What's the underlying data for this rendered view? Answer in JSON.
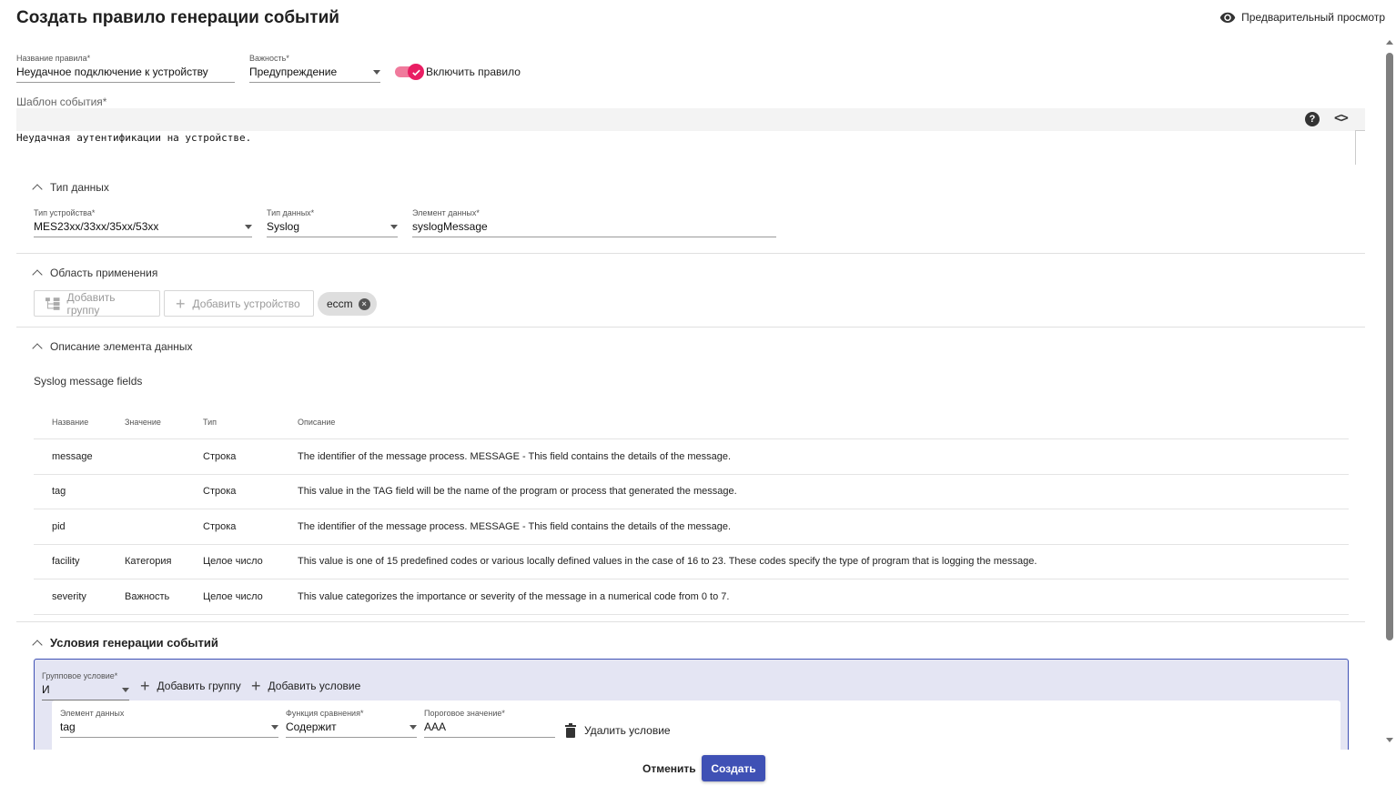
{
  "page": {
    "title": "Создать правило генерации событий",
    "preview_label": "Предварительный просмотр"
  },
  "rule": {
    "name_label": "Название правила*",
    "name_value": "Неудачное подключение к устройству",
    "severity_label": "Важность*",
    "severity_value": "Предупреждение",
    "enable_label": "Включить правило",
    "enabled": true
  },
  "template": {
    "label": "Шаблон события*",
    "text": "Неудачная аутентификации на устройстве.",
    "help_icon": "?",
    "code_icon": "<>"
  },
  "data_type_section": {
    "title": "Тип данных",
    "device_type_label": "Тип устройства*",
    "device_type_value": "MES23xx/33xx/35xx/53xx",
    "data_type_label": "Тип данных*",
    "data_type_value": "Syslog",
    "data_element_label": "Элемент данных*",
    "data_element_value": "syslogMessage"
  },
  "scope_section": {
    "title": "Область применения",
    "add_group_label": "Добавить группу",
    "add_device_label": "Добавить устройство",
    "chip_label": "eccm",
    "chip_remove_icon": "×"
  },
  "description_section": {
    "title": "Описание элемента данных",
    "subtitle": "Syslog message fields",
    "columns": [
      "Название",
      "Значение",
      "Тип",
      "Описание"
    ],
    "rows": [
      [
        "message",
        "",
        "Строка",
        "The identifier of the message process. MESSAGE - This field contains the details of the message."
      ],
      [
        "tag",
        "",
        "Строка",
        "This value in the TAG field will be the name of the program or process that generated the message."
      ],
      [
        "pid",
        "",
        "Строка",
        "The identifier of the message process. MESSAGE - This field contains the details of the message."
      ],
      [
        "facility",
        "Категория",
        "Целое число",
        "This value is one of 15 predefined codes or various locally defined values in the case of 16 to 23. These codes specify the type of program that is logging the message."
      ],
      [
        "severity",
        "Важность",
        "Целое число",
        "This value categorizes the importance or severity of the message in a numerical code from 0 to 7."
      ]
    ]
  },
  "conditions_section": {
    "title": "Условия генерации событий",
    "group_condition_label": "Групповое условие*",
    "group_condition_value": "И",
    "add_group_label": "Добавить группу",
    "add_condition_label": "Добавить условие",
    "condition": {
      "data_element_label": "Элемент данных",
      "data_element_value": "tag",
      "compare_label": "Функция сравнения*",
      "compare_value": "Содержит",
      "threshold_label": "Пороговое значение*",
      "threshold_value": "AAA",
      "delete_label": "Удалить условие"
    }
  },
  "footer": {
    "cancel_label": "Отменить",
    "create_label": "Создать"
  },
  "colors": {
    "accent": "#3f51b5",
    "toggle": "#e91e63",
    "condition_bg": "#e4e5f3"
  }
}
